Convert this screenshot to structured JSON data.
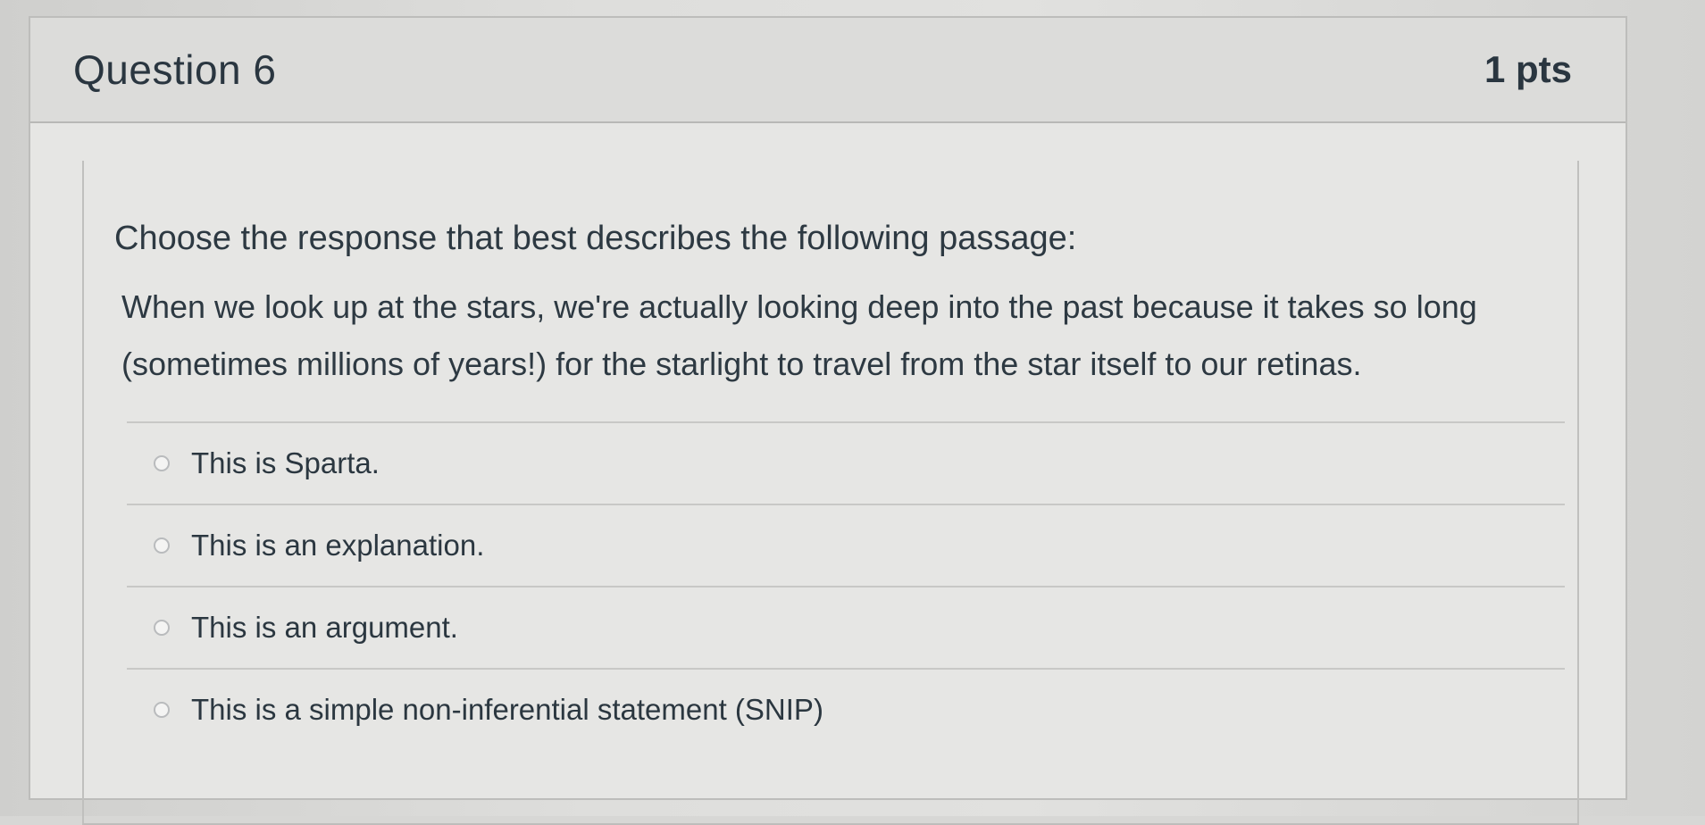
{
  "question": {
    "title": "Question 6",
    "points": "1 pts"
  },
  "prompt": "Choose the response that best describes the following passage:",
  "passage": "When we look up at the stars, we're actually looking deep into the past because it takes so long (sometimes millions of years!) for the starlight to travel from the star itself to our retinas.",
  "answers": [
    {
      "label": "This is Sparta."
    },
    {
      "label": "This is an explanation."
    },
    {
      "label": "This is an argument."
    },
    {
      "label": "This is a simple non-inferential statement (SNIP)"
    }
  ]
}
